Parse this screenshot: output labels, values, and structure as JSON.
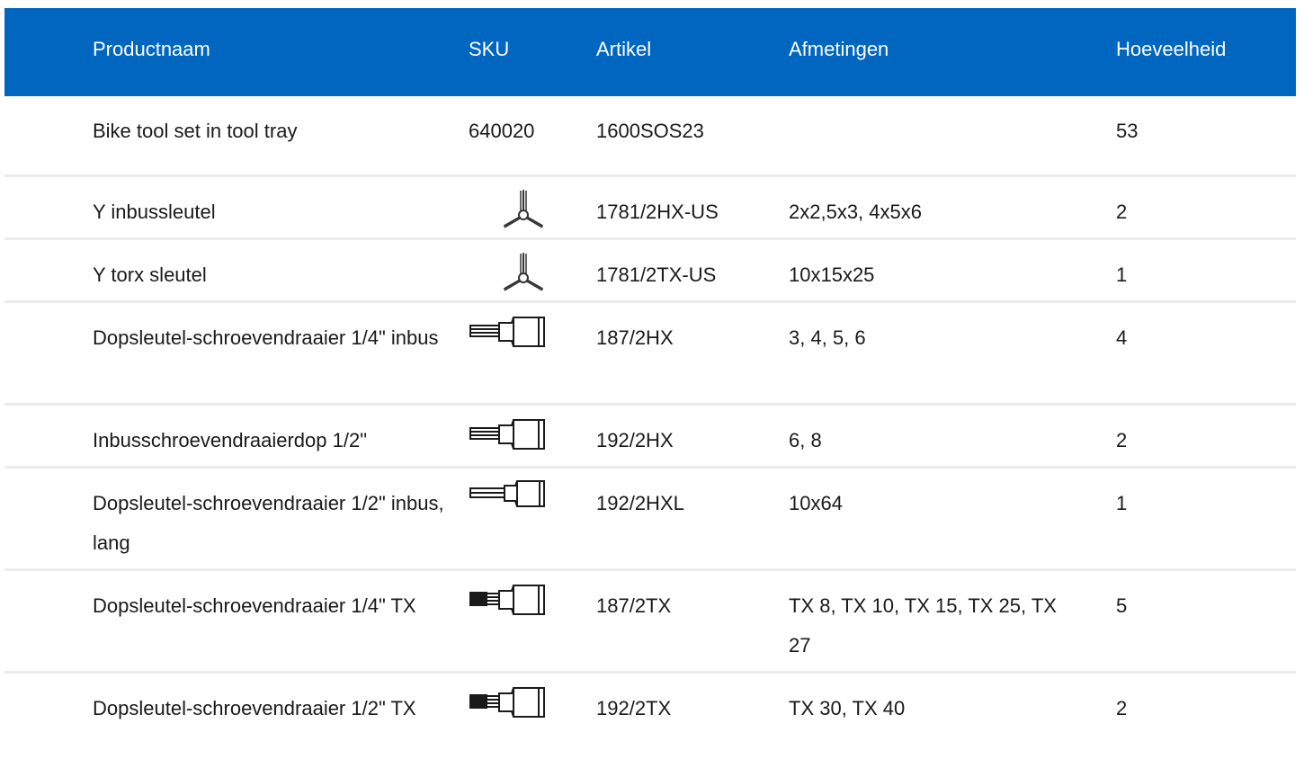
{
  "table": {
    "headers": {
      "name": "Productnaam",
      "sku": "SKU",
      "article": "Artikel",
      "dimensions": "Afmetingen",
      "quantity": "Hoeveelheid"
    },
    "rows": [
      {
        "name": "Bike tool set in tool tray",
        "sku": "640020",
        "article": "1600SOS23",
        "dimensions": "",
        "quantity": "53",
        "icon": ""
      },
      {
        "name": "Y inbussleutel",
        "sku": "",
        "article": "1781/2HX-US",
        "dimensions": "2x2,5x3, 4x5x6",
        "quantity": "2",
        "icon": "y-wrench-icon"
      },
      {
        "name": "Y torx sleutel",
        "sku": "",
        "article": "1781/2TX-US",
        "dimensions": "10x15x25",
        "quantity": "1",
        "icon": "y-wrench-icon"
      },
      {
        "name": "Dopsleutel-schroevendraaier 1/4\" inbus",
        "sku": "",
        "article": "187/2HX",
        "dimensions": "3, 4, 5, 6",
        "quantity": "4",
        "icon": "hex-bit-socket-icon"
      },
      {
        "name": "Inbusschroevendraaierdop 1/2\"",
        "sku": "",
        "article": "192/2HX",
        "dimensions": "6, 8",
        "quantity": "2",
        "icon": "hex-bit-socket-icon"
      },
      {
        "name": "Dopsleutel-schroevendraaier 1/2\" inbus, lang",
        "sku": "",
        "article": "192/2HXL",
        "dimensions": "10x64",
        "quantity": "1",
        "icon": "long-hex-bit-socket-icon"
      },
      {
        "name": "Dopsleutel-schroevendraaier 1/4\" TX",
        "sku": "",
        "article": "187/2TX",
        "dimensions": "TX 8, TX 10, TX 15, TX 25, TX 27",
        "quantity": "5",
        "icon": "torx-bit-socket-icon"
      },
      {
        "name": "Dopsleutel-schroevendraaier 1/2\" TX",
        "sku": "",
        "article": "192/2TX",
        "dimensions": "TX 30, TX 40",
        "quantity": "2",
        "icon": "torx-bit-socket-icon"
      }
    ]
  }
}
